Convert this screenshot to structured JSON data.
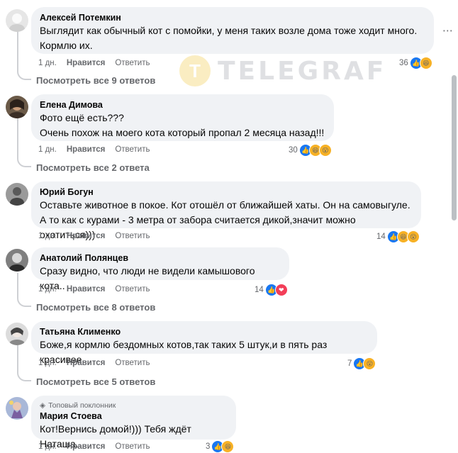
{
  "watermark": {
    "text": "TELEGRAF",
    "logo_letter": "T"
  },
  "actions": {
    "time": "1 дн.",
    "like": "Нравится",
    "reply": "Ответить"
  },
  "comments": [
    {
      "author": "Алексей Потемкин",
      "text": "Выглядит как обычный кот с помойки, у меня таких возле дома тоже ходит много.\nКормлю их.",
      "reactions_count": "36",
      "see_all": "Посмотреть все 9 ответов"
    },
    {
      "author": "Елена Димова",
      "text": "Фото ещё есть???\nОчень похож на моего кота который пропал 2 месяца назад!!!",
      "reactions_count": "30",
      "see_all": "Посмотреть все 2 ответа"
    },
    {
      "author": "Юрий Богун",
      "text": "Оставьте животное в покое. Кот отошёл от ближайшей хаты. Он на самовыгуле.\nА то как с курами - 3 метра от забора считается дикой,значит можно охотиться)))",
      "reactions_count": "14",
      "see_all": ""
    },
    {
      "author": "Анатолий Полянцев",
      "text": "Сразу видно, что люди не видели камышового кота..",
      "reactions_count": "14",
      "see_all": "Посмотреть все 8 ответов"
    },
    {
      "author": "Татьяна Клименко",
      "text": "Боже,я кормлю бездомных котов,так таких 5 штук,и в пять раз красивее",
      "reactions_count": "7",
      "see_all": "Посмотреть все 5 ответов"
    },
    {
      "author": "Мария Стоева",
      "top_fan": "Топовый поклонник",
      "text": "Кот!Вернись домой!))) Тебя ждёт Наташа.",
      "reactions_count": "3",
      "see_all": ""
    }
  ],
  "colors": {
    "like": "#1877f2",
    "haha": "#f7b125",
    "love": "#f33e58",
    "bubble": "#f0f2f5",
    "muted": "#65676b"
  },
  "icons": [
    "like-icon",
    "haha-icon",
    "wow-icon",
    "love-icon",
    "diamond-icon",
    "more-icon"
  ]
}
